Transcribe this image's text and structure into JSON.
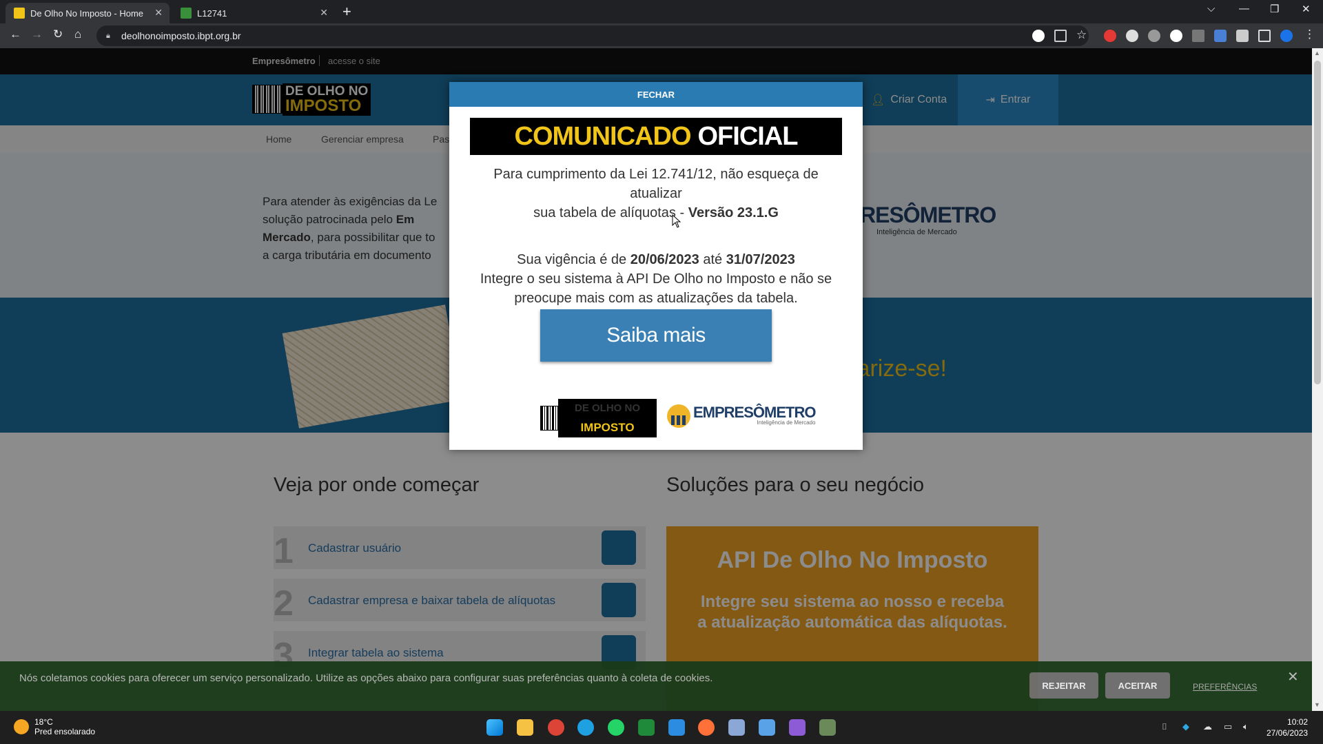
{
  "browser": {
    "tabs": [
      {
        "title": "De Olho No Imposto - Home"
      },
      {
        "title": "L12741"
      }
    ],
    "url": "deolhonoimposto.ibpt.org.br"
  },
  "site": {
    "topbar": {
      "brand": "Empresômetro",
      "link": "acesse o site"
    },
    "logo": {
      "line1": "DE OLHO NO",
      "line2": "IMPOSTO"
    },
    "header": {
      "criar_conta": "Criar Conta",
      "entrar": "Entrar"
    },
    "menu": [
      "Home",
      "Gerenciar empresa",
      "Pas"
    ],
    "hero": {
      "text_a": "Para atender às exigências da Le",
      "text_b": "solução patrocinada pelo ",
      "text_b_bold": "Em",
      "text_c_bold": "Mercado",
      "text_c": ", para possibilitar que to",
      "text_d": "a carga tributária em documento",
      "brand": "RESÔMETRO",
      "brand_sub": "Inteligência de Mercado"
    },
    "band": {
      "slogan": "larize-se!"
    },
    "sections": {
      "left_title": "Veja por onde começar",
      "right_title": "Soluções para o seu negócio"
    },
    "steps": [
      {
        "num": "1",
        "label": "Cadastrar usuário"
      },
      {
        "num": "2",
        "label": "Cadastrar empresa e baixar tabela de alíquotas"
      },
      {
        "num": "3",
        "label": "Integrar tabela ao sistema"
      }
    ],
    "api_card": {
      "title": "API De Olho No Imposto",
      "line1": "Integre seu sistema ao nosso e receba",
      "line2": "a atualização automática das alíquotas."
    }
  },
  "modal": {
    "close_label": "FECHAR",
    "banner_yellow": "COMUNICADO",
    "banner_white": "OFICIAL",
    "p1_a": "Para cumprimento da Lei 12.741/12, não esqueça de atualizar",
    "p1_b": "sua tabela de alíquotas - ",
    "p1_version": "Versão 23.1.G",
    "p2_a": "Sua vigência é de ",
    "p2_date_from": "20/06/2023",
    "p2_mid": " até ",
    "p2_date_to": "31/07/2023",
    "p3_a": "Integre o seu sistema à API De Olho no Imposto e não se",
    "p3_b": "preocupe mais com as atualizações da tabela.",
    "cta": "Saiba mais",
    "logo_left_l1": "DE OLHO NO",
    "logo_left_l2": "IMPOSTO",
    "logo_right": "EMPRESÔMETRO",
    "logo_right_sub": "Inteligência de Mercado"
  },
  "cookie": {
    "message": "Nós coletamos cookies para oferecer um serviço personalizado. Utilize as opções abaixo para configurar suas preferências quanto à coleta de cookies.",
    "reject": "REJEITAR",
    "accept": "ACEITAR",
    "preferences": "PREFERÊNCIAS"
  },
  "taskbar": {
    "temp": "18°C",
    "weather": "Pred ensolarado",
    "time": "10:02",
    "date": "27/06/2023"
  },
  "colors": {
    "accent_blue": "#1e6f9e",
    "brand_yellow": "#f0c419",
    "api_orange": "#f0a226"
  }
}
